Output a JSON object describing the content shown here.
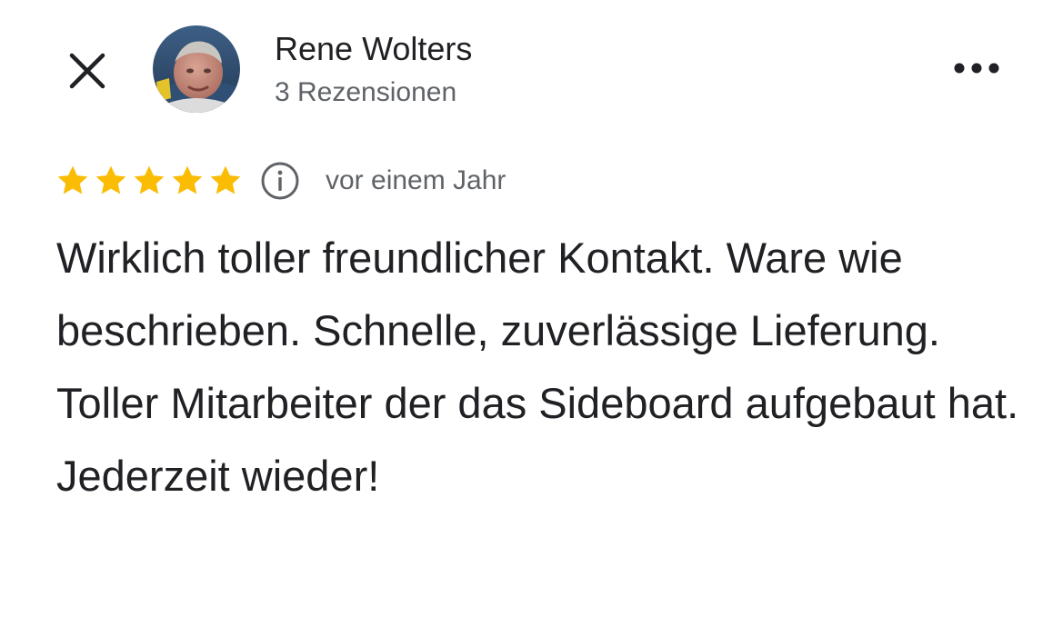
{
  "close": {
    "icon": "close-icon"
  },
  "reviewer": {
    "name": "Rene Wolters",
    "review_count": "3 Rezensionen",
    "avatar_icon": "avatar-photo"
  },
  "more": {
    "icon": "more-horizontal-icon"
  },
  "review": {
    "rating": 5,
    "max_rating": 5,
    "star_color": "#fbbc04",
    "info_icon": "info-icon",
    "date": "vor einem Jahr",
    "text": "Wirklich toller freundlicher Kontakt. Ware wie beschrieben. Schnelle, zuverlässige Lieferung. Toller Mitarbeiter der das Sideboard aufgebaut hat. Jederzeit wieder!"
  }
}
